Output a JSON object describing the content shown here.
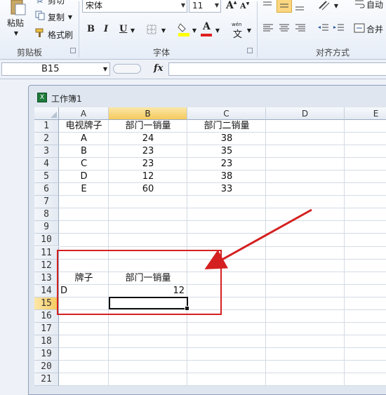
{
  "ribbon": {
    "clipboard": {
      "paste_label": "粘贴",
      "cut_label": "剪切",
      "copy_label": "复制",
      "format_painter_label": "格式刷",
      "group_label": "剪贴板"
    },
    "font": {
      "font_name": "宋体",
      "font_size": "11",
      "grow_label": "A",
      "shrink_label": "A",
      "bold_label": "B",
      "italic_label": "I",
      "underline_label": "U",
      "font_color_label": "A",
      "phonetic_label": "文",
      "phonetic_top": "wén",
      "group_label": "字体",
      "font_color": "#e02020",
      "fill_color": "#ffff00"
    },
    "alignment": {
      "wrap_label": "自动",
      "merge_label": "合并",
      "group_label": "对齐方式"
    }
  },
  "formula_bar": {
    "name_box": "B15",
    "fx_label": "fx",
    "content": ""
  },
  "workbook": {
    "title": "工作簿1"
  },
  "sheet": {
    "columns": [
      "A",
      "B",
      "C",
      "D",
      "E"
    ],
    "selected_column": "B",
    "selected_row": "15",
    "rows": [
      "1",
      "2",
      "3",
      "4",
      "5",
      "6",
      "7",
      "8",
      "9",
      "10",
      "11",
      "12",
      "13",
      "14",
      "15",
      "16",
      "17",
      "18",
      "19",
      "20",
      "21"
    ],
    "cells": {
      "A1": "电视牌子",
      "B1": "部门一销量",
      "C1": "部门二销量",
      "A2": "A",
      "B2": "24",
      "C2": "38",
      "A3": "B",
      "B3": "23",
      "C3": "35",
      "A4": "C",
      "B4": "23",
      "C4": "23",
      "A5": "D",
      "B5": "12",
      "C5": "38",
      "A6": "E",
      "B6": "60",
      "C6": "33",
      "A13": "牌子",
      "B13": "部门一销量",
      "A14": "D",
      "B14": "12"
    }
  },
  "annotation": {
    "color": "#d42020"
  }
}
